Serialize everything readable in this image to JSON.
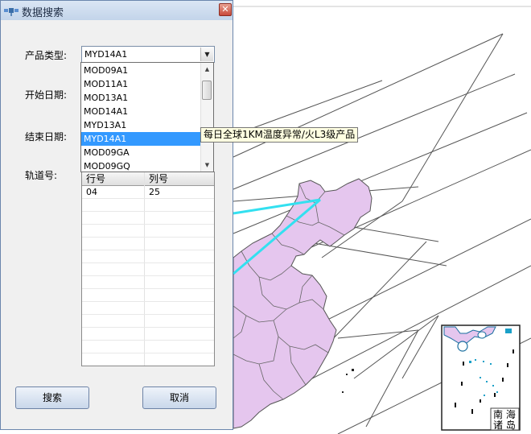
{
  "dialog": {
    "title": "数据搜索",
    "close_symbol": "✕"
  },
  "form": {
    "product_type_label": "产品类型:",
    "start_date_label": "开始日期:",
    "end_date_label": "结束日期:",
    "track_label": "轨道号:"
  },
  "product_combo": {
    "value": "MYD14A1",
    "arrow": "▼",
    "options": [
      "MOD09A1",
      "MOD11A1",
      "MOD13A1",
      "MOD14A1",
      "MYD13A1",
      "MYD14A1",
      "MOD09GA",
      "MOD09GQ"
    ],
    "selected_index": 5,
    "scroll_up": "▲",
    "scroll_down": "▼"
  },
  "tooltip": "每日全球1KM温度异常/火L3级产品",
  "track_table": {
    "columns": [
      "行号",
      "列号"
    ],
    "rows": [
      [
        "04",
        "25"
      ]
    ]
  },
  "buttons": {
    "search": "搜索",
    "cancel": "取消"
  },
  "inset_map": {
    "label_line1": "南 海",
    "label_line2": "诸 岛"
  },
  "colors": {
    "province_fill": "#e5c6ee",
    "track_highlight": "#33e0f0",
    "selection": "#3399ff",
    "tooltip_bg": "#ffffe1"
  }
}
